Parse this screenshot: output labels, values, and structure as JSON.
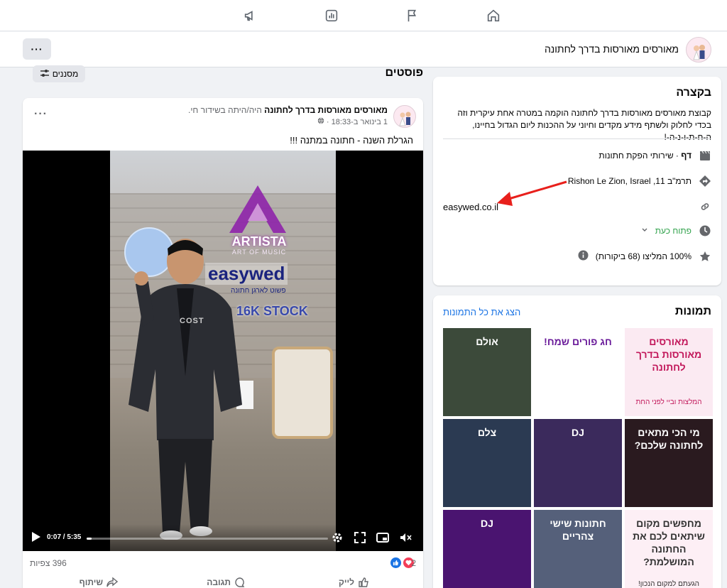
{
  "page": {
    "name": "מאורסים מאורסות בדרך לחתונה",
    "more_label": "···"
  },
  "posts_section": {
    "title": "פוסטים",
    "filter_label": "מסננים"
  },
  "post": {
    "author": "מאורסים מאורסות בדרך לחתונה",
    "author_suffix": "היה/היתה בשידור חי.",
    "meta": "1 בינואר ב-18:33 ·",
    "more_label": "···",
    "caption": "הגרלת השנה - חתונה במתנה !!!",
    "video": {
      "current_time": "0:07",
      "duration": "5:35",
      "time_label": "0:07 / 5:35",
      "progress": 0.021,
      "sign_artista": "ARTISTA",
      "sign_artista_sub": "ART OF MUSIC",
      "sign_easywed": "easywed",
      "sign_easywed_sub": "פשוט לארגן חתונה",
      "sign_stock": "16K STOCK",
      "shirt_text": "COST"
    },
    "views": "396 צפיות",
    "reactions_count": "2",
    "actions": {
      "like": "לייק",
      "comment": "תגובה",
      "share": "שיתוף"
    }
  },
  "intro": {
    "title": "בקצרה",
    "description": "קבוצת מאורסים מאורסות בדרך לחתונה הוקמה במטרה אחת עיקרית וזה בכדי לחלוק ולשתף מידע מקדים וחיוני על ההכנות ליום הגדול בחיינו, ה-ח-ת-ו-נ-ה-!",
    "category_prefix": "דף",
    "category": "· שירותי הפקת חתונות",
    "address": "תרמ\"ב 11, Rishon Le Zion, Israel",
    "website": "easywed.co.il",
    "hours": "פתוח כעת",
    "rating": "100% המליצו (68 ביקורות)"
  },
  "photos": {
    "title": "תמונות",
    "see_all": "הצג את כל התמונות",
    "tiles": [
      {
        "label": "מאורסים מאורסות בדרך לחתונה",
        "sub": "המלצות וביי לפני החת",
        "bg": "#fbeaf2",
        "fg": "#c2185b"
      },
      {
        "label": "חג פורים שמח!",
        "sub": "",
        "bg": "#ffffff",
        "fg": "#6a1b9a"
      },
      {
        "label": "אולם",
        "sub": "",
        "bg": "#3c4a3a",
        "fg": "#ffffff"
      },
      {
        "label": "מי הכי מתאים לחתונה שלכם?",
        "sub": "",
        "bg": "#2a1a1f",
        "fg": "#ffffff"
      },
      {
        "label": "DJ",
        "sub": "",
        "bg": "#3b2a5c",
        "fg": "#ffffff"
      },
      {
        "label": "צלם",
        "sub": "",
        "bg": "#2b3a52",
        "fg": "#ffffff"
      },
      {
        "label": "מחפשים מקום שיתאים לכם את החתונה המושלמת?",
        "sub": "הגעתם למקום הנכון!",
        "bg": "#fdeff5",
        "fg": "#333333"
      },
      {
        "label": "חתונות שישי צהריים",
        "sub": "",
        "bg": "#55607a",
        "fg": "#ffffff"
      },
      {
        "label": "DJ",
        "sub": "",
        "bg": "#4a1470",
        "fg": "#ffffff"
      }
    ]
  },
  "colors": {
    "accent": "#1b74e4",
    "open_green": "#31a24c",
    "arrow_red": "#e8201c"
  }
}
